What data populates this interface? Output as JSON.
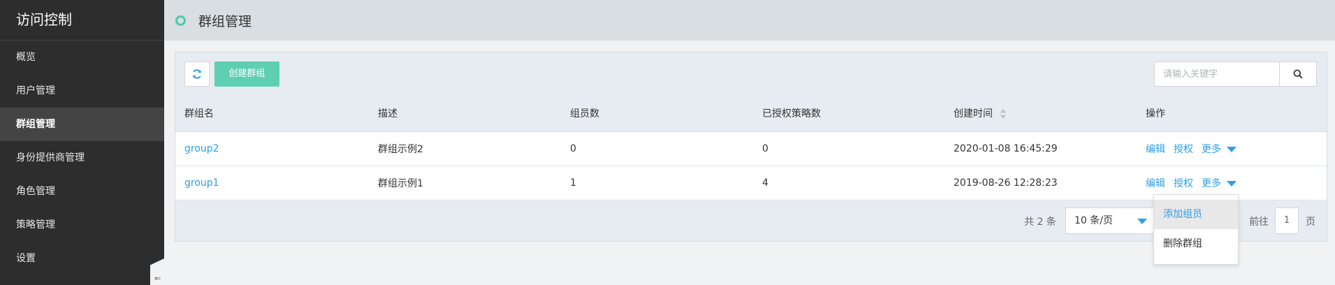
{
  "sidebar": {
    "title": "访问控制",
    "items": [
      {
        "label": "概览"
      },
      {
        "label": "用户管理"
      },
      {
        "label": "群组管理"
      },
      {
        "label": "身份提供商管理"
      },
      {
        "label": "角色管理"
      },
      {
        "label": "策略管理"
      },
      {
        "label": "设置"
      }
    ],
    "active_index": 2,
    "collapse_glyph": "⇐"
  },
  "header": {
    "title": "群组管理"
  },
  "toolbar": {
    "create_label": "创建群组",
    "search_placeholder": "请输入关键字"
  },
  "table": {
    "columns": [
      "群组名",
      "描述",
      "组员数",
      "已授权策略数",
      "创建时间",
      "操作"
    ],
    "rows": [
      {
        "name": "group2",
        "description": "群组示例2",
        "members": "0",
        "policies": "0",
        "created": "2020-01-08 16:45:29"
      },
      {
        "name": "group1",
        "description": "群组示例1",
        "members": "1",
        "policies": "4",
        "created": "2019-08-26 12:28:23"
      }
    ],
    "actions": {
      "edit": "编辑",
      "authorize": "授权",
      "more": "更多"
    }
  },
  "pagination": {
    "total_text": "共 2 条",
    "page_size": "10 条/页",
    "goto_label": "前往",
    "current_page": "1",
    "page_suffix": "页"
  },
  "dropdown": {
    "items": [
      {
        "label": "添加组员"
      },
      {
        "label": "删除群组"
      }
    ]
  },
  "colors": {
    "accent": "#5fcfb3",
    "link": "#2e9fe6",
    "sidebar_bg": "#2d2d2d"
  }
}
